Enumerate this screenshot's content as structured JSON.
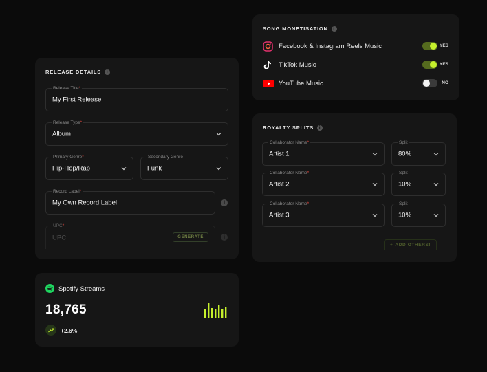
{
  "release_details": {
    "title": "RELEASE DETAILS",
    "release_title": {
      "label": "Release Title",
      "value": "My First Release"
    },
    "release_type": {
      "label": "Release Type",
      "value": "Album"
    },
    "primary_genre": {
      "label": "Primary Genre",
      "value": "Hip-Hop/Rap"
    },
    "secondary_genre": {
      "label": "Secondary Genre",
      "value": "Funk"
    },
    "record_label": {
      "label": "Record Label",
      "value": "My Own Record Label"
    },
    "upc": {
      "label": "UPC",
      "placeholder": "UPC",
      "button": "GENERATE"
    }
  },
  "song_monetisation": {
    "title": "SONG MONETISATION",
    "rows": [
      {
        "label": "Facebook & Instagram Reels Music",
        "state": "YES",
        "icon": "instagram-icon",
        "on": true
      },
      {
        "label": "TikTok Music",
        "state": "YES",
        "icon": "tiktok-icon",
        "on": true
      },
      {
        "label": "YouTube Music",
        "state": "NO",
        "icon": "youtube-icon",
        "on": false
      }
    ]
  },
  "royalty_splits": {
    "title": "ROYALTY SPLITS",
    "collaborator_label": "Collaborator Name",
    "split_label": "Split",
    "rows": [
      {
        "name": "Artist 1",
        "split": "80%"
      },
      {
        "name": "Artist 2",
        "split": "10%"
      },
      {
        "name": "Artist 3",
        "split": "10%"
      }
    ],
    "add_button": "ADD OTHERS!"
  },
  "spotify": {
    "title": "Spotify Streams",
    "count": "18,765",
    "change": "+2.6%"
  },
  "colors": {
    "accent": "#c6f02c",
    "background": "#0b0b0b",
    "card": "#161616",
    "required": "#e0463f"
  }
}
